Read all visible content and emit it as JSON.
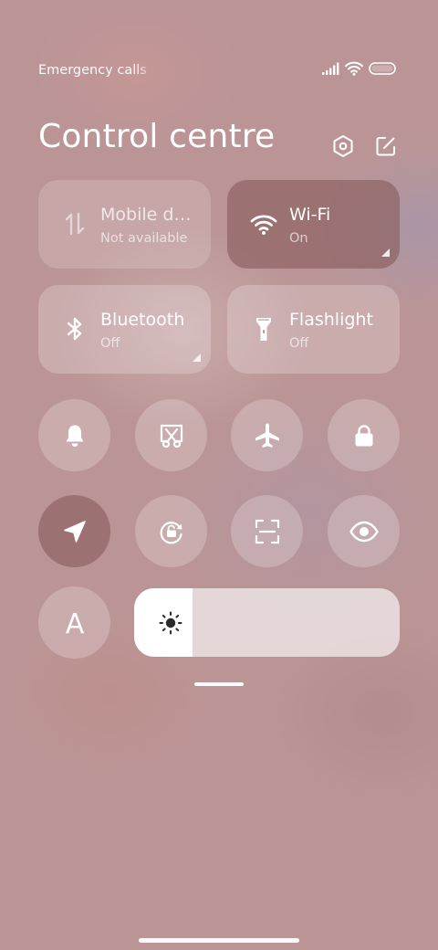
{
  "status_bar": {
    "text": "Emergency calls only",
    "icons": [
      "signal-icon",
      "wifi-icon",
      "battery-icon"
    ]
  },
  "header": {
    "title": "Control centre",
    "icons": [
      "settings-icon",
      "edit-icon"
    ]
  },
  "tiles": [
    {
      "label": "Mobile data",
      "status": "Not available",
      "icon": "mobile-data-icon",
      "active": false
    },
    {
      "label": "Wi-Fi",
      "status": "On",
      "icon": "wifi-icon",
      "active": true
    },
    {
      "label": "Bluetooth",
      "status": "Off",
      "icon": "bluetooth-icon",
      "active": false
    },
    {
      "label": "Flashlight",
      "status": "Off",
      "icon": "flashlight-icon",
      "active": false
    }
  ],
  "toggles": [
    {
      "icon": "bell-icon",
      "active": false
    },
    {
      "icon": "screenshot-icon",
      "active": false
    },
    {
      "icon": "airplane-icon",
      "active": false
    },
    {
      "icon": "lock-icon",
      "active": false
    },
    {
      "icon": "location-icon",
      "active": true
    },
    {
      "icon": "rotation-lock-icon",
      "active": false
    },
    {
      "icon": "scanner-icon",
      "active": false
    },
    {
      "icon": "eye-icon",
      "active": false
    },
    {
      "icon": "font-size-icon",
      "label": "A",
      "active": false
    }
  ],
  "brightness": {
    "level": 0.22,
    "icon": "brightness-icon"
  },
  "colors": {
    "background": "#bb9596",
    "active_tile": "#875a5a",
    "foreground": "#ffffff"
  }
}
